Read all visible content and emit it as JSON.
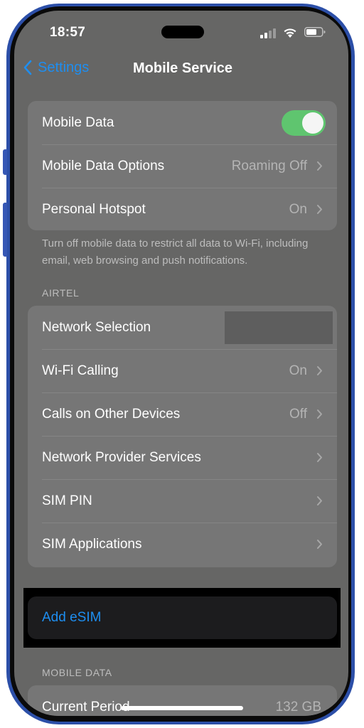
{
  "status_bar": {
    "time": "18:57"
  },
  "nav": {
    "back_label": "Settings",
    "title": "Mobile Service"
  },
  "group1": {
    "rows": [
      {
        "label": "Mobile Data",
        "toggle_on": true
      },
      {
        "label": "Mobile Data Options",
        "value": "Roaming Off"
      },
      {
        "label": "Personal Hotspot",
        "value": "On"
      }
    ],
    "footnote": "Turn off mobile data to restrict all data to Wi-Fi, including email, web browsing and push notifications."
  },
  "carrier_section": {
    "header": "AIRTEL",
    "rows": [
      {
        "label": "Network Selection",
        "value": ""
      },
      {
        "label": "Wi-Fi Calling",
        "value": "On"
      },
      {
        "label": "Calls on Other Devices",
        "value": "Off"
      },
      {
        "label": "Network Provider Services",
        "value": ""
      },
      {
        "label": "SIM PIN",
        "value": ""
      },
      {
        "label": "SIM Applications",
        "value": ""
      }
    ]
  },
  "esim": {
    "label": "Add eSIM"
  },
  "mobile_data_section": {
    "header": "MOBILE DATA",
    "rows": [
      {
        "label": "Current Period",
        "value": "132 GB"
      }
    ]
  },
  "colors": {
    "accent": "#1e8ef0",
    "toggle_on": "#5fc56f",
    "frame": "#2c4fa8"
  }
}
